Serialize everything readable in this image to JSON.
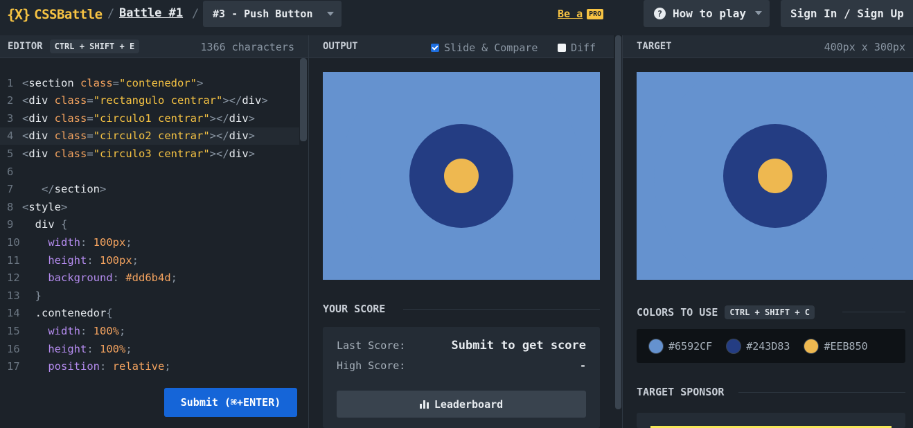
{
  "header": {
    "logo_mark": "{X}",
    "logo_text": "CSSBattle",
    "separator": "/",
    "battle_label": "Battle #1",
    "target_select": "#3 - Push Button",
    "pro_text": "Be a",
    "pro_badge": "PRO",
    "how_to_play": "How to play",
    "how_icon": "?",
    "sign_in": "Sign In / Sign Up"
  },
  "editor": {
    "title": "EDITOR",
    "shortcut": "CTRL + SHIFT + E",
    "char_count": "1366 characters",
    "submit": "Submit (⌘+ENTER)",
    "lines": [
      {
        "n": "1",
        "parts": [
          {
            "c": "punc",
            "t": "<"
          },
          {
            "c": "tag",
            "t": "section "
          },
          {
            "c": "attr",
            "t": "class"
          },
          {
            "c": "punc",
            "t": "="
          },
          {
            "c": "str",
            "t": "\"contenedor\""
          },
          {
            "c": "punc",
            "t": ">"
          }
        ]
      },
      {
        "n": "2",
        "parts": [
          {
            "c": "punc",
            "t": "<"
          },
          {
            "c": "tag",
            "t": "div "
          },
          {
            "c": "attr",
            "t": "class"
          },
          {
            "c": "punc",
            "t": "="
          },
          {
            "c": "str",
            "t": "\"rectangulo centrar\""
          },
          {
            "c": "punc",
            "t": "></"
          },
          {
            "c": "tag",
            "t": "div"
          },
          {
            "c": "punc",
            "t": ">"
          }
        ]
      },
      {
        "n": "3",
        "parts": [
          {
            "c": "punc",
            "t": "<"
          },
          {
            "c": "tag",
            "t": "div "
          },
          {
            "c": "attr",
            "t": "class"
          },
          {
            "c": "punc",
            "t": "="
          },
          {
            "c": "str",
            "t": "\"circulo1 centrar\""
          },
          {
            "c": "punc",
            "t": "></"
          },
          {
            "c": "tag",
            "t": "div"
          },
          {
            "c": "punc",
            "t": ">"
          }
        ]
      },
      {
        "n": "4",
        "active": true,
        "parts": [
          {
            "c": "punc",
            "t": "<"
          },
          {
            "c": "tag",
            "t": "div "
          },
          {
            "c": "attr",
            "t": "class"
          },
          {
            "c": "punc",
            "t": "="
          },
          {
            "c": "str",
            "t": "\"circulo2 centrar\""
          },
          {
            "c": "punc",
            "t": "></"
          },
          {
            "c": "tag",
            "t": "div"
          },
          {
            "c": "punc",
            "t": ">"
          }
        ]
      },
      {
        "n": "5",
        "parts": [
          {
            "c": "punc",
            "t": "<"
          },
          {
            "c": "tag",
            "t": "div "
          },
          {
            "c": "attr",
            "t": "class"
          },
          {
            "c": "punc",
            "t": "="
          },
          {
            "c": "str",
            "t": "\"circulo3 centrar\""
          },
          {
            "c": "punc",
            "t": "></"
          },
          {
            "c": "tag",
            "t": "div"
          },
          {
            "c": "punc",
            "t": ">"
          }
        ]
      },
      {
        "n": "6",
        "parts": []
      },
      {
        "n": "7",
        "parts": [
          {
            "c": "tag",
            "t": "   "
          },
          {
            "c": "punc",
            "t": "</"
          },
          {
            "c": "tag",
            "t": "section"
          },
          {
            "c": "punc",
            "t": ">"
          }
        ]
      },
      {
        "n": "8",
        "parts": [
          {
            "c": "punc",
            "t": "<"
          },
          {
            "c": "tag",
            "t": "style"
          },
          {
            "c": "punc",
            "t": ">"
          }
        ]
      },
      {
        "n": "9",
        "parts": [
          {
            "c": "tag",
            "t": "  div "
          },
          {
            "c": "punc",
            "t": "{"
          }
        ]
      },
      {
        "n": "10",
        "parts": [
          {
            "c": "tag",
            "t": "    "
          },
          {
            "c": "prop",
            "t": "width"
          },
          {
            "c": "punc",
            "t": ": "
          },
          {
            "c": "num",
            "t": "100px"
          },
          {
            "c": "punc",
            "t": ";"
          }
        ]
      },
      {
        "n": "11",
        "parts": [
          {
            "c": "tag",
            "t": "    "
          },
          {
            "c": "prop",
            "t": "height"
          },
          {
            "c": "punc",
            "t": ": "
          },
          {
            "c": "num",
            "t": "100px"
          },
          {
            "c": "punc",
            "t": ";"
          }
        ]
      },
      {
        "n": "12",
        "parts": [
          {
            "c": "tag",
            "t": "    "
          },
          {
            "c": "prop",
            "t": "background"
          },
          {
            "c": "punc",
            "t": ": "
          },
          {
            "c": "num",
            "t": "#dd6b4d"
          },
          {
            "c": "punc",
            "t": ";"
          }
        ]
      },
      {
        "n": "13",
        "parts": [
          {
            "c": "tag",
            "t": "  "
          },
          {
            "c": "punc",
            "t": "}"
          }
        ]
      },
      {
        "n": "14",
        "parts": [
          {
            "c": "tag",
            "t": "  .contenedor"
          },
          {
            "c": "punc",
            "t": "{"
          }
        ]
      },
      {
        "n": "15",
        "parts": [
          {
            "c": "tag",
            "t": "    "
          },
          {
            "c": "prop",
            "t": "width"
          },
          {
            "c": "punc",
            "t": ": "
          },
          {
            "c": "num",
            "t": "100%"
          },
          {
            "c": "punc",
            "t": ";"
          }
        ]
      },
      {
        "n": "16",
        "parts": [
          {
            "c": "tag",
            "t": "    "
          },
          {
            "c": "prop",
            "t": "height"
          },
          {
            "c": "punc",
            "t": ": "
          },
          {
            "c": "num",
            "t": "100%"
          },
          {
            "c": "punc",
            "t": ";"
          }
        ]
      },
      {
        "n": "17",
        "parts": [
          {
            "c": "tag",
            "t": "    "
          },
          {
            "c": "prop",
            "t": "position"
          },
          {
            "c": "punc",
            "t": ": "
          },
          {
            "c": "num",
            "t": "relative"
          },
          {
            "c": "punc",
            "t": ";"
          }
        ]
      }
    ]
  },
  "output": {
    "title": "OUTPUT",
    "slide_compare": "Slide & Compare",
    "slide_checked": true,
    "diff": "Diff",
    "diff_checked": false
  },
  "target": {
    "title": "TARGET",
    "size": "400px x 300px"
  },
  "score": {
    "title": "YOUR SCORE",
    "last_label": "Last Score:",
    "last_value": "Submit to get score",
    "high_label": "High Score:",
    "high_value": "-",
    "leaderboard": "Leaderboard"
  },
  "colors": {
    "title": "COLORS TO USE",
    "shortcut": "CTRL + SHIFT + C",
    "items": [
      {
        "hex": "#6592CF"
      },
      {
        "hex": "#243D83"
      },
      {
        "hex": "#EEB850"
      }
    ]
  },
  "sponsor": {
    "title": "TARGET SPONSOR"
  }
}
